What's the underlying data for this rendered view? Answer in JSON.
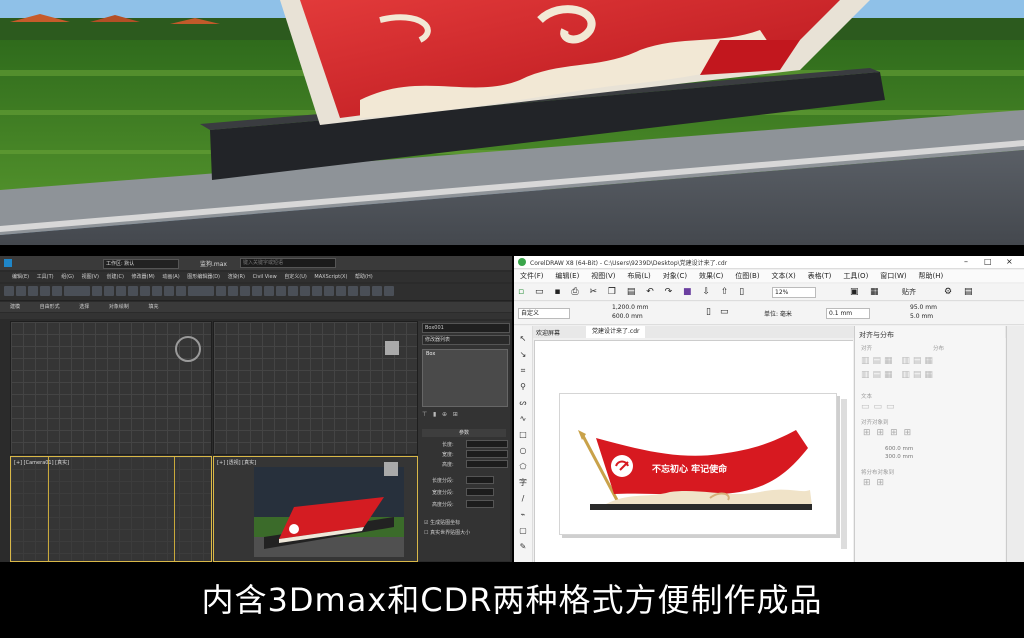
{
  "max": {
    "tab_title": "监狗.max",
    "search_placeholder": "键入关键字或短语",
    "workspace": "工作区: 默认",
    "menus": [
      "编辑(E)",
      "工具(T)",
      "组(G)",
      "视图(V)",
      "创建(C)",
      "修改器(M)",
      "动画(A)",
      "图形编辑器(D)",
      "渲染(R)",
      "Civil View",
      "自定义(U)",
      "MAXScript(X)",
      "帮助(H)"
    ],
    "tabs": [
      "建模",
      "自由形式",
      "选择",
      "对象绘制",
      "填充"
    ],
    "viewport_labels": [
      "[+] [Camera01] [真实]",
      "[+] [透视] [真实]"
    ],
    "sidebar": {
      "object_name": "Box001",
      "modifier_list": "修改器列表",
      "stack_item": "Box"
    },
    "params": {
      "header": "参数",
      "length": "长度:",
      "width": "宽度:",
      "height": "高度:",
      "length_segs": "长度分段:",
      "width_segs": "宽度分段:",
      "height_segs": "高度分段:",
      "gen_map": "生成贴图坐标",
      "real_world": "真实世界贴图大小"
    }
  },
  "cdr": {
    "title": "CorelDRAW X8 (64-Bit) - C:\\Users\\9239D\\Desktop\\党建设计来了.cdr",
    "menus": [
      "文件(F)",
      "编辑(E)",
      "视图(V)",
      "布局(L)",
      "对象(C)",
      "效果(C)",
      "位图(B)",
      "文本(X)",
      "表格(T)",
      "工具(O)",
      "窗口(W)",
      "帮助(H)"
    ],
    "zoom": "12%",
    "snap": "贴齐",
    "preset": "自定义",
    "width": "1,200.0 mm",
    "height": "600.0 mm",
    "unit": "单位: 毫米",
    "nudge": "0.1 mm",
    "dup_x": "95.0 mm",
    "dup_y": "5.0 mm",
    "tabs": [
      "欢迎屏幕",
      "党建设计来了.cdr"
    ],
    "panel_title": "对齐与分布",
    "panel_sections": [
      "对齐",
      "分布",
      "文本",
      "对齐对象到",
      "将分布对象到"
    ],
    "panel_w": "600.0 mm",
    "panel_h": "300.0 mm",
    "sign_text": "不忘初心 牢记使命"
  },
  "caption": "内含3Dmax和CDR两种格式方便制作成品"
}
